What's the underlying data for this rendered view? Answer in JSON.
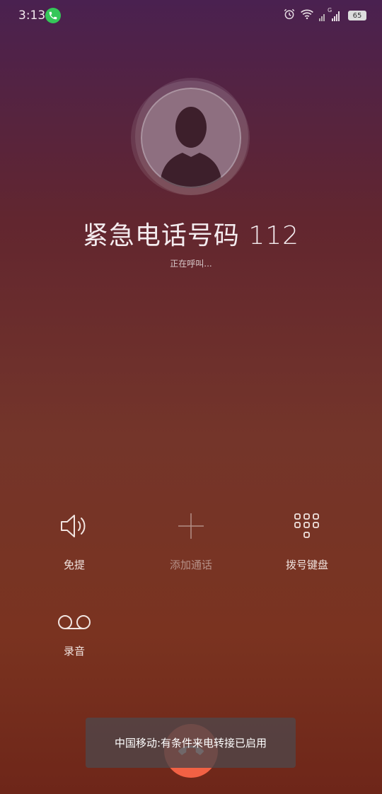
{
  "status_bar": {
    "time": "3:13",
    "battery": "65",
    "network_label": "G",
    "icons": [
      "phone-call-icon",
      "alarm-icon",
      "wifi-icon",
      "signal-icon",
      "battery-icon"
    ]
  },
  "call": {
    "name": "紧急电话号码 112",
    "status": "正在呼叫..."
  },
  "actions": {
    "speaker": "免提",
    "add_call": "添加通话",
    "keypad": "拨号键盘",
    "record": "录音"
  },
  "toast": {
    "message": "中国移动:有条件来电转接已启用"
  },
  "colors": {
    "hangup": "#f26144",
    "call_indicator": "#35c759"
  }
}
